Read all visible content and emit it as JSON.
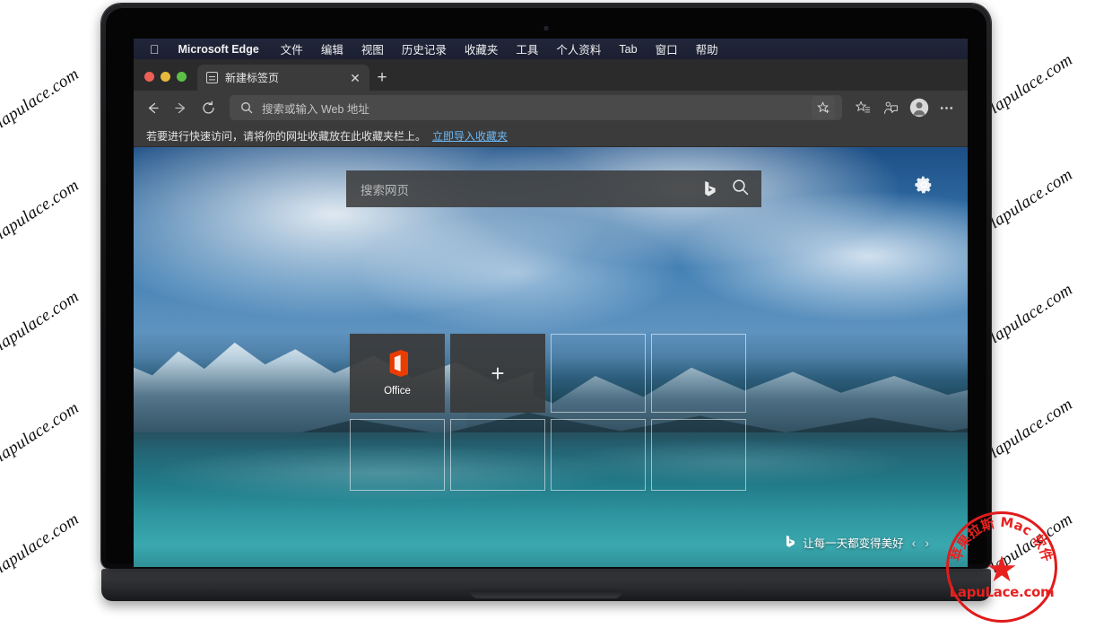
{
  "menubar": {
    "apple_icon": "apple-logo",
    "items": [
      {
        "label": "Microsoft Edge",
        "bold": true
      },
      {
        "label": "文件",
        "bold": false
      },
      {
        "label": "编辑",
        "bold": false
      },
      {
        "label": "视图",
        "bold": false
      },
      {
        "label": "历史记录",
        "bold": false
      },
      {
        "label": "收藏夹",
        "bold": false
      },
      {
        "label": "工具",
        "bold": false
      },
      {
        "label": "个人资料",
        "bold": false
      },
      {
        "label": "Tab",
        "bold": false
      },
      {
        "label": "窗口",
        "bold": false
      },
      {
        "label": "帮助",
        "bold": false
      }
    ]
  },
  "browser": {
    "tab": {
      "title": "新建标签页",
      "favicon": "newtab-icon",
      "close_label": "✕"
    },
    "new_tab_button": "+",
    "toolbar": {
      "back": "←",
      "forward": "→",
      "reload": "⟳",
      "address_placeholder": "搜索或输入 Web 地址",
      "search_icon": "search-icon",
      "favorite_icon": "star-plus-icon",
      "favorites_icon": "favorites-list-icon",
      "collections_icon": "collections-icon",
      "profile_icon": "profile-avatar-icon",
      "more_icon": "more-options-icon"
    },
    "bookmarkbar": {
      "hint": "若要进行快速访问，请将你的网址收藏放在此收藏夹栏上。",
      "import_link": "立即导入收藏夹"
    }
  },
  "newtab": {
    "search_placeholder": "搜索网页",
    "bing_icon": "bing-logo-icon",
    "search_icon": "search-icon",
    "settings_icon": "gear-icon",
    "tiles": [
      {
        "label": "Office",
        "type": "app",
        "icon": "office-icon"
      },
      {
        "label": "+",
        "type": "add",
        "icon": "plus-icon"
      },
      {
        "label": "",
        "type": "empty",
        "icon": ""
      },
      {
        "label": "",
        "type": "empty",
        "icon": ""
      },
      {
        "label": "",
        "type": "empty",
        "icon": ""
      },
      {
        "label": "",
        "type": "empty",
        "icon": ""
      },
      {
        "label": "",
        "type": "empty",
        "icon": ""
      },
      {
        "label": "",
        "type": "empty",
        "icon": ""
      }
    ],
    "tagline": {
      "icon": "bing-logo-icon",
      "text": "让每一天都变得美好",
      "prev": "‹",
      "next": "›"
    }
  },
  "device": {
    "bezel_label": "LapuLace.com"
  },
  "watermarks": {
    "text": "lapulace.com",
    "stamp_url": "LapuLace.com",
    "stamp_top_text": "苹果拉斯 Mac 软件",
    "stamp_star": "★"
  },
  "colors": {
    "menubar": "#1f2336",
    "toolbar": "#3b3b3b",
    "tab_active": "#3b3b3b",
    "accent_link": "#6cb8f5",
    "office_orange": "#eb3c00",
    "stamp_red": "#e8211f"
  }
}
